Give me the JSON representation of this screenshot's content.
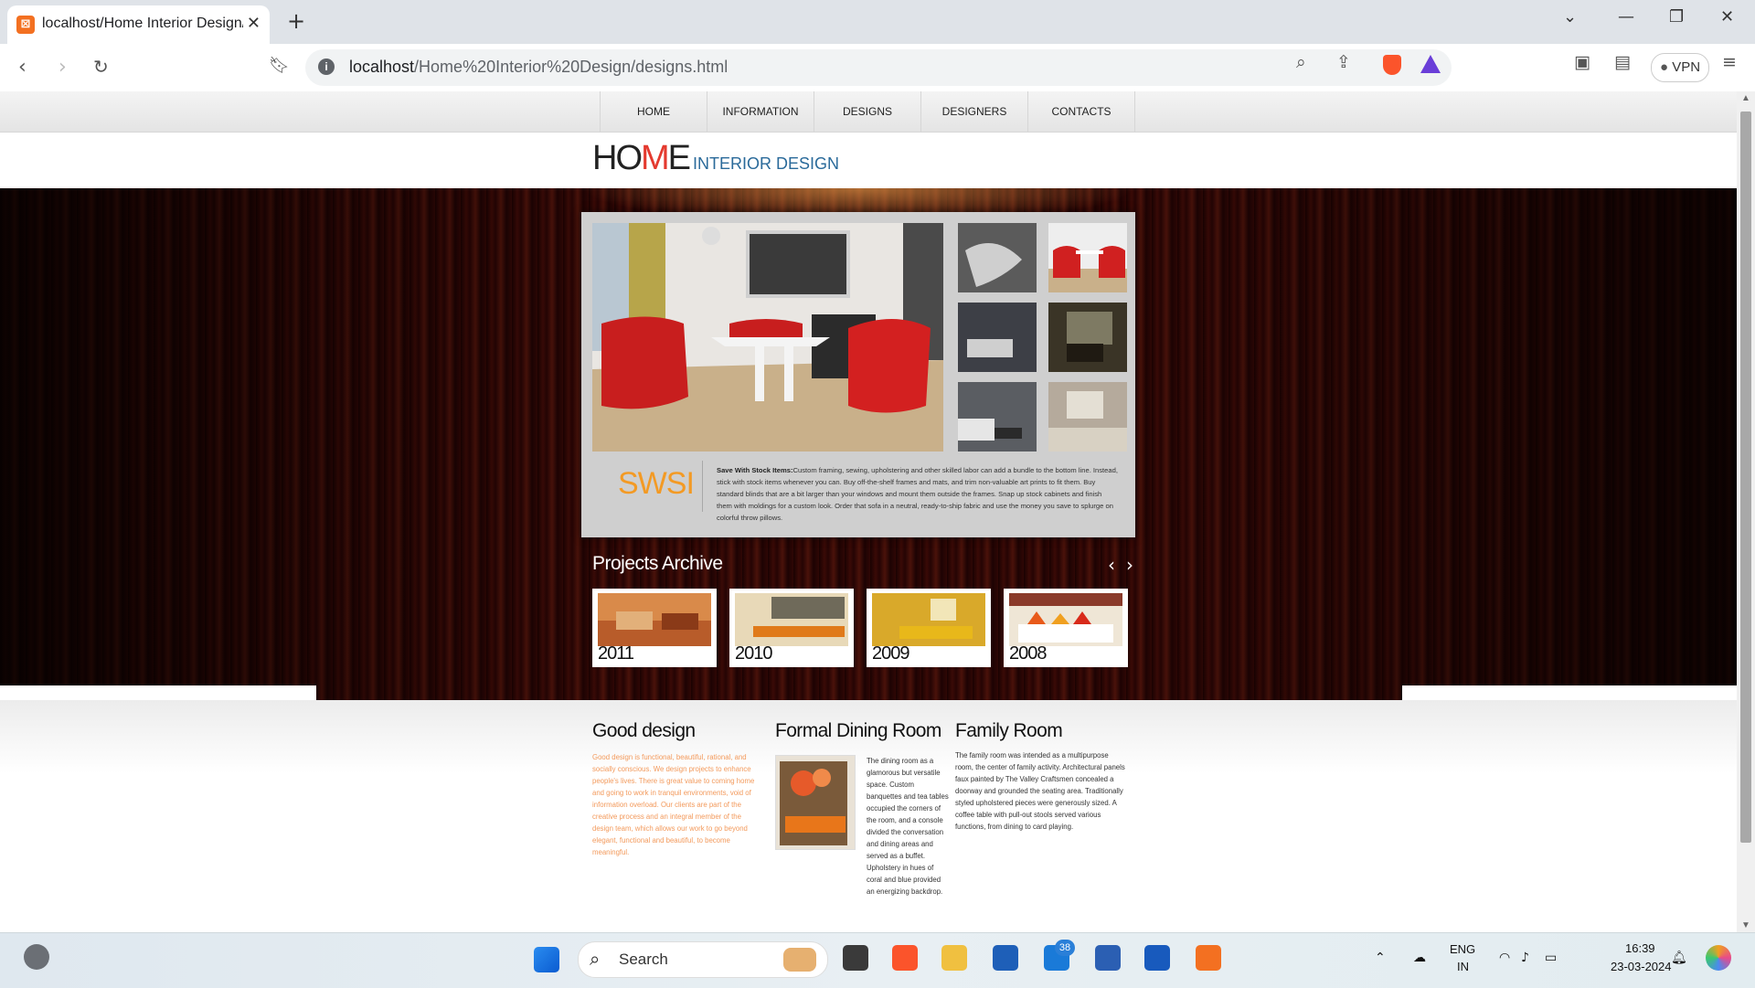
{
  "browser": {
    "tab_title": "localhost/Home Interior Design/",
    "url_host": "localhost",
    "url_path": "/Home%20Interior%20Design/designs.html",
    "vpn_label": "VPN"
  },
  "nav": {
    "items": [
      "HOME",
      "INFORMATION",
      "DESIGNS",
      "DESIGNERS",
      "CONTACTS"
    ]
  },
  "logo": {
    "ho": "HO",
    "m": "M",
    "e": "E",
    "sub": "INTERIOR DESIGN"
  },
  "slider": {
    "brand": "SWSI",
    "desc_bold": "Save With Stock Items:",
    "desc_text": "Custom framing, sewing, upholstering and other skilled labor can add a bundle to the bottom line. Instead, stick with stock items whenever you can. Buy off-the-shelf frames and mats, and trim non-valuable art prints to fit them. Buy standard blinds that are a bit larger than your windows and mount them outside the frames. Snap up stock cabinets and finish them with moldings for a custom look. Order that sofa in a neutral, ready-to-ship fabric and use the money you save to splurge on colorful throw pillows."
  },
  "archive": {
    "title": "Projects Archive",
    "years": [
      "2011",
      "2010",
      "2009",
      "2008"
    ]
  },
  "columns": {
    "good": {
      "title": "Good design",
      "text": "Good design is functional, beautiful, rational, and socially conscious. We design projects to enhance people's lives. There is great value to coming home and going to work in tranquil environments, void of information overload. Our clients are part of the creative process and an integral member of the design team, which allows our work to go beyond elegant, functional and beautiful, to become meaningful."
    },
    "dining": {
      "title": "Formal Dining Room",
      "text": "The dining room as a glamorous but versatile space. Custom banquettes and tea tables occupied the corners of the room, and a console divided the conversation and dining areas and served as a buffet. Upholstery in hues of coral and blue provided an energizing backdrop."
    },
    "family": {
      "title": "Family Room",
      "text": "The family room was intended as a multipurpose room, the center of family activity. Architectural panels faux painted by The Valley Craftsmen concealed a doorway and grounded the seating area. Traditionally styled upholstered pieces were generously sized. A coffee table with pull-out stools served various functions, from dining to card playing."
    }
  },
  "taskbar": {
    "search_label": "Search",
    "badge_count": "38",
    "lang_top": "ENG",
    "lang_bottom": "IN",
    "time": "16:39",
    "date": "23-03-2024"
  },
  "colors": {
    "accent_orange": "#f39a24",
    "logo_red": "#e43a2f",
    "logo_blue": "#2a6a9a"
  }
}
